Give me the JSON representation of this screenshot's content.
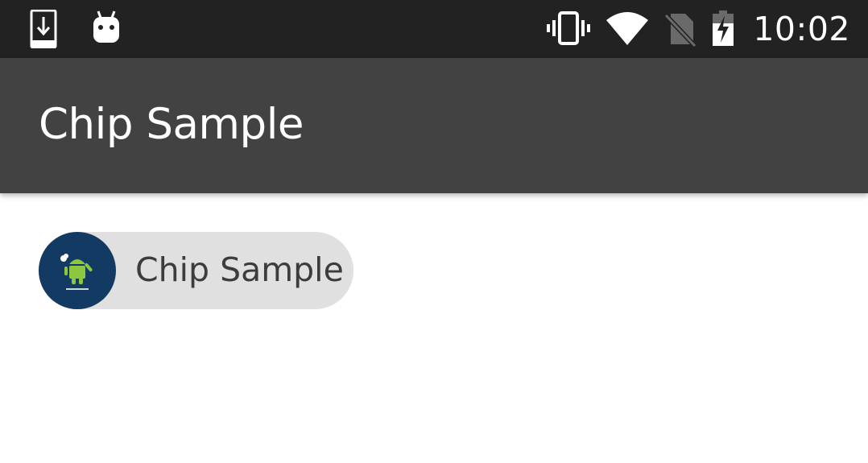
{
  "status_bar": {
    "time": "10:02",
    "icons": [
      "download-notification-icon",
      "android-debug-icon",
      "vibrate-icon",
      "wifi-icon",
      "no-sim-icon",
      "battery-charging-icon"
    ],
    "background_color": "#222222"
  },
  "app_bar": {
    "title": "Chip Sample",
    "background_color": "#424242"
  },
  "chip": {
    "label": "Chip Sample",
    "avatar": "android-logo-avatar",
    "avatar_color": "#123a63",
    "background_color": "#e0e0e0"
  }
}
